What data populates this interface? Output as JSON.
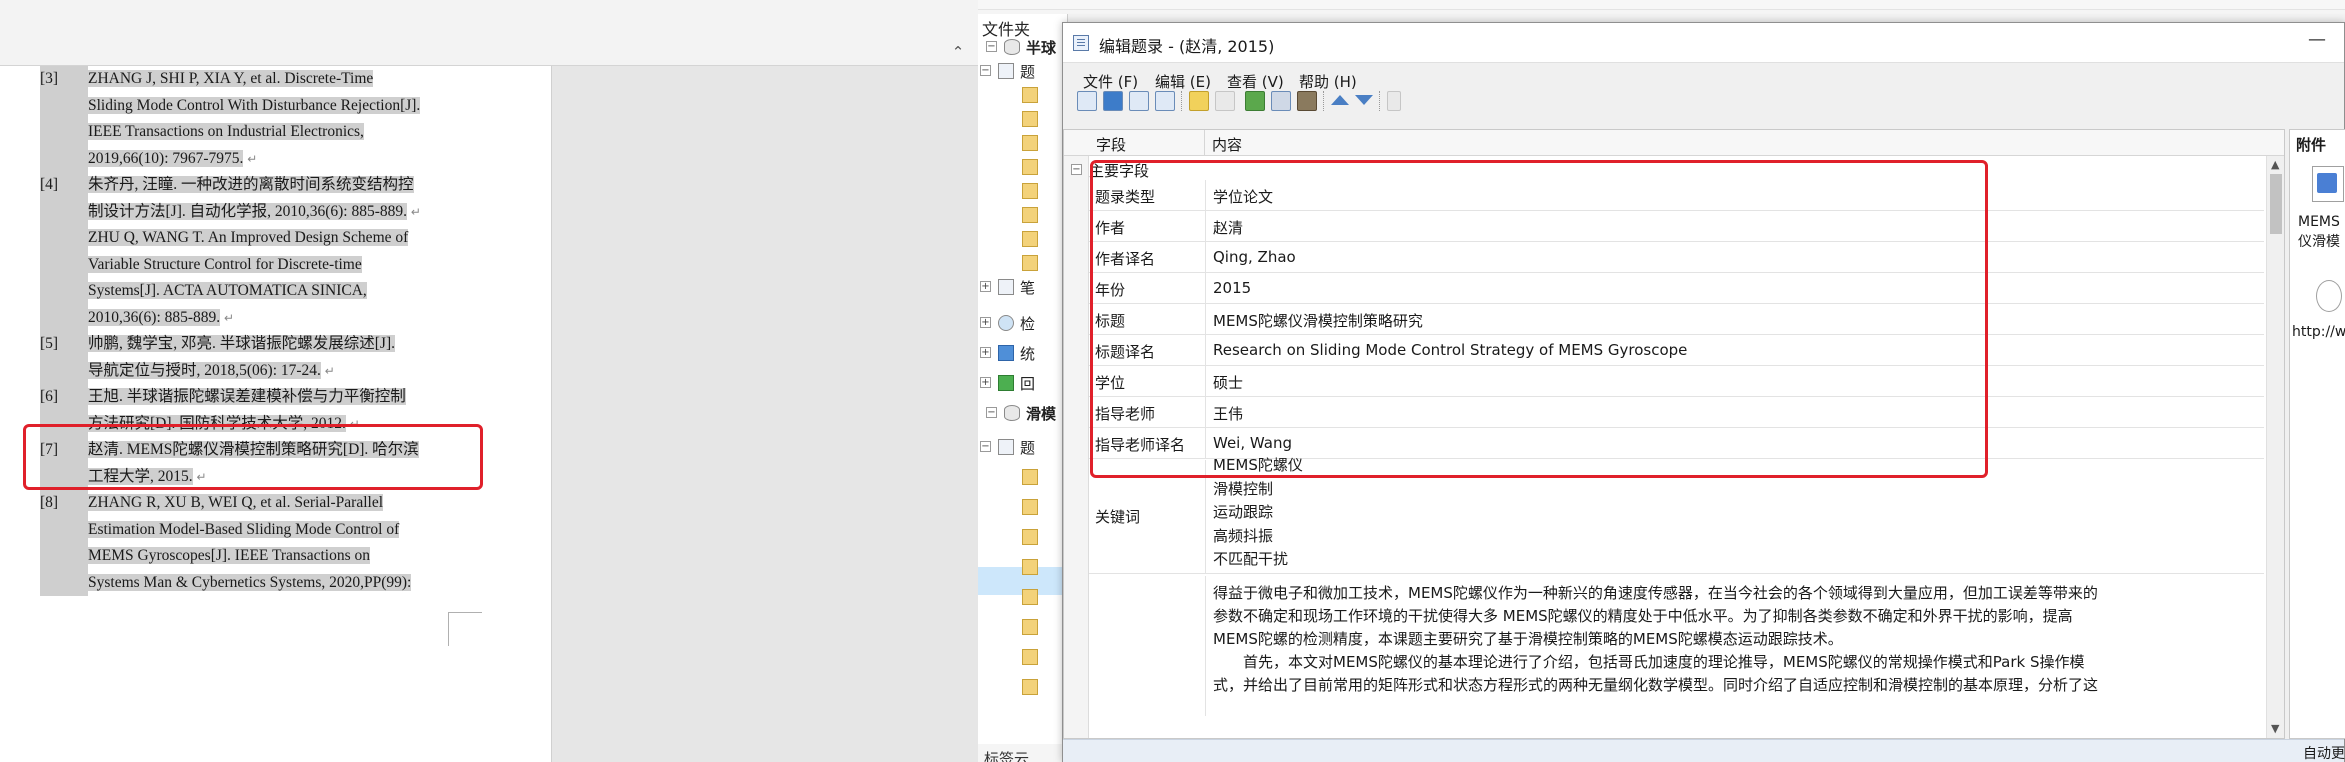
{
  "word": {
    "references": [
      {
        "num": "[3]",
        "lines": [
          "ZHANG J, SHI P, XIA Y, et al. Discrete-Time",
          "Sliding Mode Control With Disturbance Rejection[J].",
          "IEEE Transactions on Industrial Electronics,",
          "2019,66(10): 7967-7975."
        ]
      },
      {
        "num": "[4]",
        "lines": [
          "朱齐丹, 汪瞳. 一种改进的离散时间系统变结构控",
          "制设计方法[J]. 自动化学报, 2010,36(6): 885-889.",
          "ZHU Q, WANG T. An Improved Design Scheme of",
          "Variable Structure Control for Discrete-time",
          "Systems[J]. ACTA AUTOMATICA SINICA,",
          "2010,36(6): 885-889."
        ]
      },
      {
        "num": "[5]",
        "lines": [
          "帅鹏, 魏学宝, 邓亮. 半球谐振陀螺发展综述[J].",
          "导航定位与授时, 2018,5(06): 17-24."
        ]
      },
      {
        "num": "[6]",
        "lines": [
          "王旭. 半球谐振陀螺误差建模补偿与力平衡控制",
          "方法研究[D]. 国防科学技术大学, 2012."
        ]
      },
      {
        "num": "[7]",
        "lines": [
          "赵清. MEMS陀螺仪滑模控制策略研究[D]. 哈尔滨",
          "工程大学, 2015."
        ]
      },
      {
        "num": "[8]",
        "lines": [
          "ZHANG R, XU B, WEI Q, et al. Serial-Parallel",
          "Estimation Model-Based Sliding Mode Control of",
          "MEMS Gyroscopes[J]. IEEE Transactions on",
          "Systems Man & Cybernetics Systems, 2020,PP(99):"
        ]
      }
    ]
  },
  "endnote": {
    "folder_label": "文件夹",
    "tree": [
      {
        "label": "半球",
        "icon": "db"
      },
      {
        "label": "题",
        "icon": "list"
      },
      {
        "label": "",
        "icon": "folder"
      },
      {
        "label": "",
        "icon": "folder"
      },
      {
        "label": "",
        "icon": "folder"
      },
      {
        "label": "",
        "icon": "folder"
      },
      {
        "label": "",
        "icon": "folder"
      },
      {
        "label": "",
        "icon": "folder"
      },
      {
        "label": "",
        "icon": "folder"
      },
      {
        "label": "",
        "icon": "folder"
      },
      {
        "label": "笔",
        "icon": "list"
      },
      {
        "label": "检",
        "icon": "mag"
      },
      {
        "label": "统",
        "icon": "grid"
      },
      {
        "label": "回",
        "icon": "tree2"
      },
      {
        "label": "滑模",
        "icon": "db"
      },
      {
        "label": "题",
        "icon": "list"
      },
      {
        "label": "",
        "icon": "folder"
      },
      {
        "label": "",
        "icon": "folder"
      },
      {
        "label": "",
        "icon": "folder"
      },
      {
        "label": "",
        "icon": "folder"
      },
      {
        "label": "",
        "icon": "folder"
      },
      {
        "label": "",
        "icon": "folder"
      },
      {
        "label": "",
        "icon": "folder"
      },
      {
        "label": "",
        "icon": "folder"
      }
    ],
    "bottom_label": "标签云"
  },
  "edit_window": {
    "title": "编辑题录 - (赵清, 2015)",
    "menus": [
      "文件 (F)",
      "编辑 (E)",
      "查看 (V)",
      "帮助 (H)"
    ],
    "columns": {
      "field": "字段",
      "content": "内容"
    },
    "group_label": "主要字段",
    "fields": [
      {
        "name": "题录类型",
        "value": "学位论文"
      },
      {
        "name": "作者",
        "value": "赵清"
      },
      {
        "name": "作者译名",
        "value": "Qing, Zhao"
      },
      {
        "name": "年份",
        "value": "2015"
      },
      {
        "name": "标题",
        "value": "MEMS陀螺仪滑模控制策略研究"
      },
      {
        "name": "标题译名",
        "value": "Research on Sliding Mode Control Strategy of MEMS Gyroscope"
      },
      {
        "name": "学位",
        "value": "硕士"
      },
      {
        "name": "指导老师",
        "value": "王伟"
      },
      {
        "name": "指导老师译名",
        "value": "Wei, Wang"
      }
    ],
    "keywords_label": "关键词",
    "keywords": [
      "MEMS陀螺仪",
      "滑模控制",
      "运动跟踪",
      "高频抖振",
      "不匹配干扰"
    ],
    "abstract_lines": [
      "得益于微电子和微加工技术，MEMS陀螺仪作为一种新兴的角速度传感器，在当今社会的各个领域得到大量应用，但加工误差等带来的",
      "参数不确定和现场工作环境的干扰使得大多 MEMS陀螺仪的精度处于中低水平。为了抑制各类参数不确定和外界干扰的影响，提高",
      "MEMS陀螺的检测精度，本课题主要研究了基于滑模控制策略的MEMS陀螺模态运动跟踪技术。",
      "　　首先，本文对MEMS陀螺仪的基本理论进行了介绍，包括哥氏加速度的理论推导，MEMS陀螺仪的常规操作模式和Park S操作模",
      "式，并给出了目前常用的矩阵形式和状态方程形式的两种无量纲化数学模型。同时介绍了自适应控制和滑模控制的基本原理，分析了这"
    ],
    "attachments_title": "附件",
    "attachment1_lines": [
      "MEMS",
      "仪滑模"
    ],
    "attachment2_url": "http://w",
    "status": "自动更",
    "minimize_glyph": "—"
  }
}
